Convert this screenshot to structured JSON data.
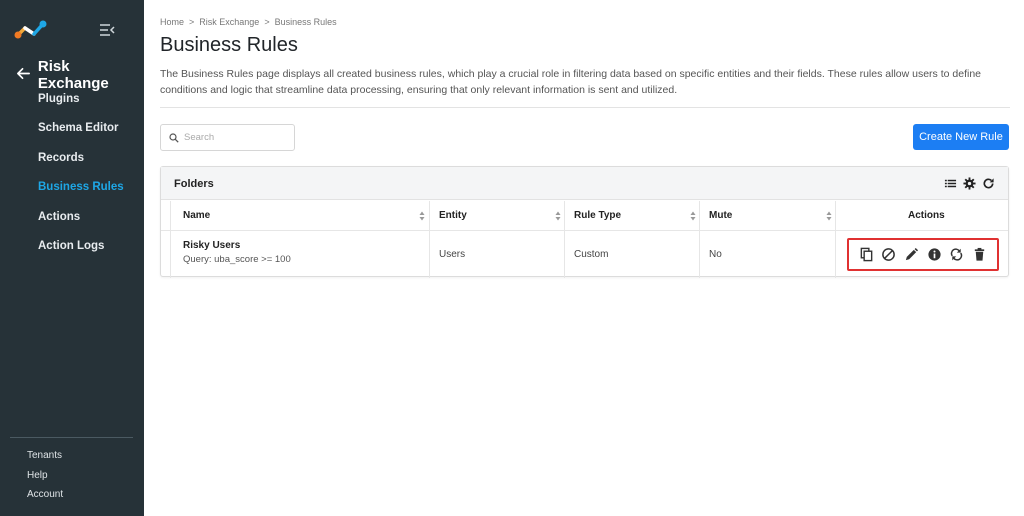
{
  "sidebar": {
    "back_title": "Risk Exchange",
    "items": [
      {
        "label": "Plugins",
        "active": false
      },
      {
        "label": "Schema Editor",
        "active": false
      },
      {
        "label": "Records",
        "active": false
      },
      {
        "label": "Business Rules",
        "active": true
      },
      {
        "label": "Actions",
        "active": false
      },
      {
        "label": "Action Logs",
        "active": false
      }
    ],
    "bottom": [
      {
        "label": "Tenants"
      },
      {
        "label": "Help"
      },
      {
        "label": "Account"
      }
    ]
  },
  "breadcrumb": {
    "items": [
      "Home",
      "Risk Exchange",
      "Business Rules"
    ],
    "separator": ">"
  },
  "page": {
    "title": "Business Rules",
    "description": "The Business Rules page displays all created business rules, which play a crucial role in filtering data based on specific entities and their fields. These rules allow users to define conditions and logic that streamline data processing, ensuring that only relevant information is sent and utilized."
  },
  "search": {
    "placeholder": "Search",
    "value": ""
  },
  "create_button": "Create New Rule",
  "panel": {
    "title": "Folders",
    "columns": [
      "Name",
      "Entity",
      "Rule Type",
      "Mute",
      "Actions"
    ],
    "rows": [
      {
        "name": "Risky Users",
        "query": "Query: uba_score >= 100",
        "entity": "Users",
        "rule_type": "Custom",
        "mute": "No"
      }
    ]
  },
  "colors": {
    "sidebar_bg": "#263238",
    "active_nav": "#1ea7e6",
    "primary_button": "#1c7ef3",
    "highlight_border": "#e03131"
  },
  "icons": {
    "row_actions": [
      "copy-icon",
      "block-icon",
      "edit-icon",
      "info-icon",
      "sync-icon",
      "delete-icon"
    ],
    "panel_tools": [
      "list-icon",
      "gear-icon",
      "refresh-icon"
    ]
  }
}
